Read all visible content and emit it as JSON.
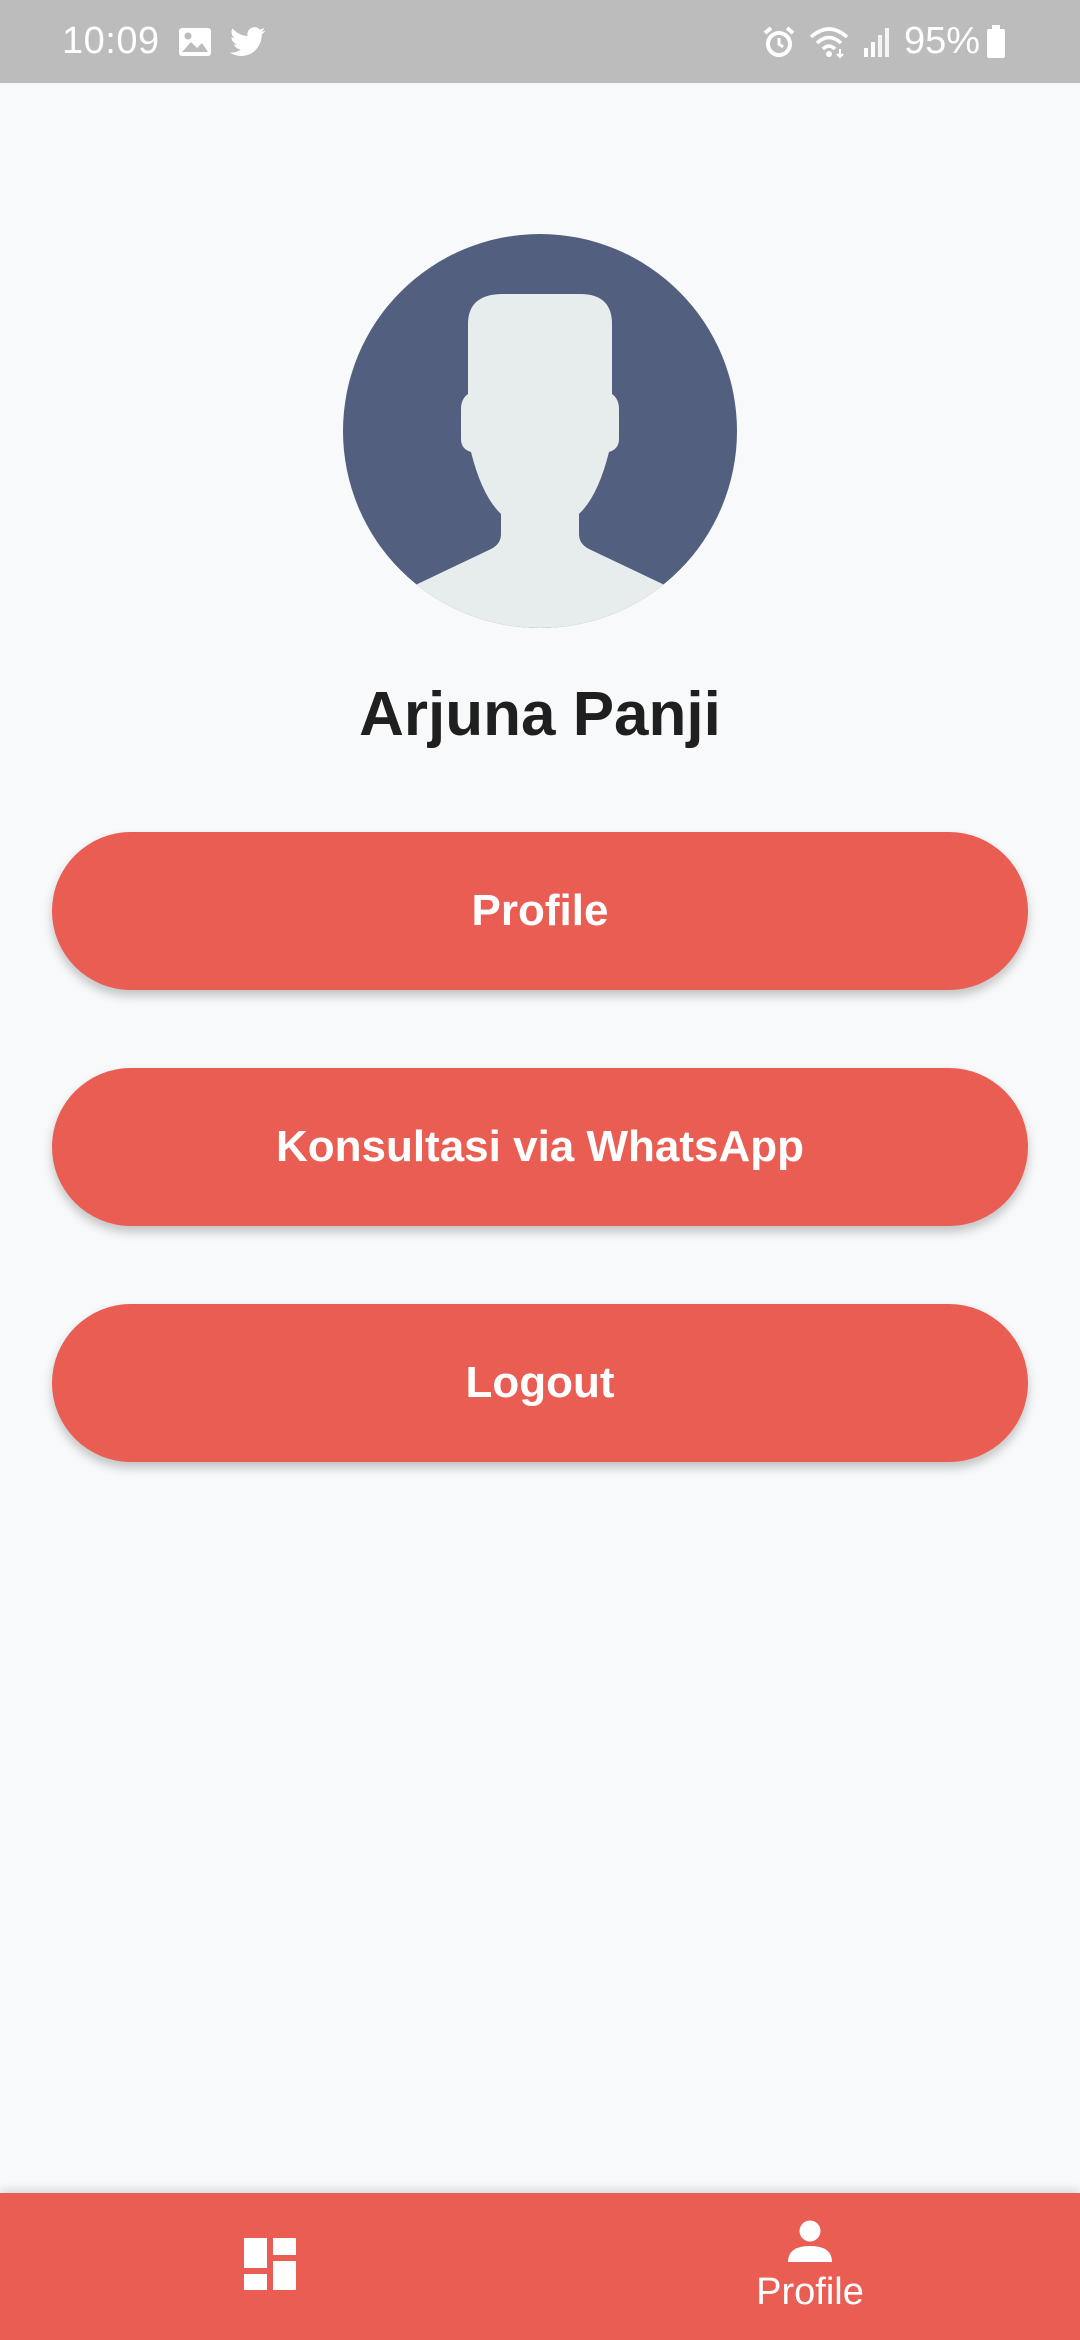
{
  "status_bar": {
    "time": "10:09",
    "battery": "95%",
    "left_icons": [
      "gallery-icon",
      "twitter-icon"
    ],
    "right_icons": [
      "alarm-icon",
      "wifi-icon",
      "signal-icon",
      "battery-icon"
    ]
  },
  "profile": {
    "name": "Arjuna Panji",
    "avatar": "default-user-avatar"
  },
  "actions": {
    "profile_label": "Profile",
    "whatsapp_label": "Konsultasi via WhatsApp",
    "logout_label": "Logout"
  },
  "bottom_nav": {
    "items": [
      {
        "icon": "dashboard-icon",
        "label": ""
      },
      {
        "icon": "person-icon",
        "label": "Profile"
      }
    ],
    "active_index": 1
  },
  "colors": {
    "accent": "#e95d53",
    "status_bar": "#bcbcbc",
    "background": "#f8f9fa",
    "avatar_bg": "#535f7f",
    "avatar_figure": "#e7eced",
    "text": "#1f1f1f"
  }
}
